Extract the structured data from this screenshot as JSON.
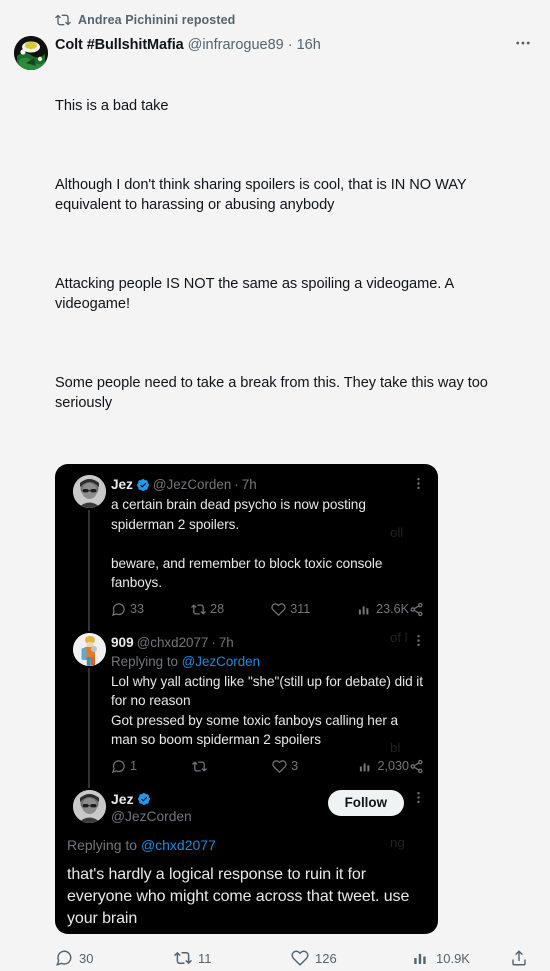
{
  "repost": {
    "icon": "repost-icon",
    "text": "Andrea Pichinini reposted"
  },
  "main_tweet": {
    "display_name": "Colt #BullshitMafia",
    "handle": "@infrarogue89",
    "separator": "·",
    "time": "16h",
    "more_icon": "more-horizontal-icon",
    "paragraphs": [
      "This is a bad take",
      "Although I don't think sharing spoilers is cool, that is IN NO WAY equivalent to harassing or abusing anybody",
      "Attacking people IS NOT the same as spoiling a videogame. A videogame!",
      "Some people need to take a break from this. They take this way too seriously"
    ],
    "actions": [
      {
        "icon": "reply-icon",
        "count": "30"
      },
      {
        "icon": "retweet-icon",
        "count": "11"
      },
      {
        "icon": "like-icon",
        "count": "126"
      },
      {
        "icon": "views-icon",
        "count": "10.9K"
      },
      {
        "icon": "share-icon",
        "count": ""
      }
    ]
  },
  "embedded_screenshot": {
    "ghosts": [
      "oll",
      "of l",
      "bl",
      "ng"
    ],
    "tweets": [
      {
        "display_name": "Jez",
        "verified": true,
        "handle": "@JezCorden",
        "separator": "·",
        "time": "7h",
        "more_icon": "more-vertical-icon",
        "replying_prefix": "",
        "replying_mention": "",
        "text": "a certain brain dead psycho is now posting spiderman 2 spoilers.\n\nbeware, and remember to block toxic console fanboys.",
        "actions": [
          {
            "icon": "reply-icon",
            "count": "33"
          },
          {
            "icon": "retweet-icon",
            "count": "28"
          },
          {
            "icon": "like-icon",
            "count": "311"
          },
          {
            "icon": "views-icon",
            "count": "23.6K"
          },
          {
            "icon": "share-icon",
            "count": ""
          }
        ]
      },
      {
        "display_name": "909",
        "verified": false,
        "handle": "@chxd2077",
        "separator": "·",
        "time": "7h",
        "more_icon": "more-vertical-icon",
        "replying_prefix": "Replying to ",
        "replying_mention": "@JezCorden",
        "text": "Lol why yall acting like \"she\"(still up for debate) did it for no reason\nGot pressed by some toxic fanboys calling her a man so boom spiderman 2 spoilers",
        "actions": [
          {
            "icon": "reply-icon",
            "count": "1"
          },
          {
            "icon": "retweet-icon",
            "count": ""
          },
          {
            "icon": "like-icon",
            "count": "3"
          },
          {
            "icon": "views-icon",
            "count": "2,030"
          },
          {
            "icon": "share-icon",
            "count": ""
          }
        ]
      },
      {
        "display_name": "Jez",
        "verified": true,
        "handle": "@JezCorden",
        "follow_label": "Follow",
        "more_icon": "more-vertical-icon",
        "replying_prefix": "Replying to ",
        "replying_mention": "@chxd2077",
        "text": "that's hardly a logical response to ruin it for everyone who might come across that tweet. use your brain"
      }
    ]
  },
  "colors": {
    "page_background": "#f4f4f4",
    "primary_text": "#0f1419",
    "secondary_text": "#536471",
    "embed_background": "#000000",
    "embed_text": "#e7e9ea",
    "embed_secondary_text": "#71767b",
    "link_blue": "#1a8cd8",
    "verified_blue": "#1d9bf0",
    "follow_button_bg": "#eff3f4"
  }
}
